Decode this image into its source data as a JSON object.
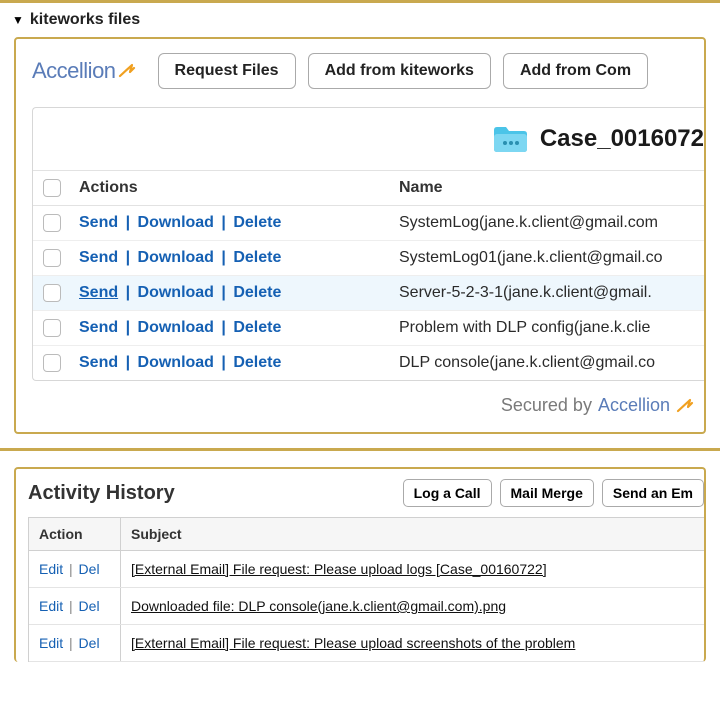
{
  "panel": {
    "title": "kiteworks files",
    "brand": "Accellion",
    "buttons": {
      "request": "Request Files",
      "add_kw": "Add from kiteworks",
      "add_com": "Add from Com"
    },
    "case_name": "Case_0016072",
    "headers": {
      "actions": "Actions",
      "name": "Name"
    },
    "action_labels": {
      "send": "Send",
      "download": "Download",
      "delete": "Delete"
    },
    "files": [
      {
        "name": "SystemLog(jane.k.client@gmail.com",
        "highlight": false
      },
      {
        "name": "SystemLog01(jane.k.client@gmail.co",
        "highlight": false
      },
      {
        "name": "Server-5-2-3-1(jane.k.client@gmail.",
        "highlight": true
      },
      {
        "name": "Problem with DLP config(jane.k.clie",
        "highlight": false
      },
      {
        "name": "DLP console(jane.k.client@gmail.co",
        "highlight": false
      }
    ],
    "secured_prefix": "Secured by",
    "secured_brand": "Accellion"
  },
  "activity": {
    "title": "Activity History",
    "buttons": {
      "log_call": "Log a Call",
      "mail_merge": "Mail Merge",
      "send_email": "Send an Em"
    },
    "headers": {
      "action": "Action",
      "subject": "Subject"
    },
    "action_labels": {
      "edit": "Edit",
      "del": "Del"
    },
    "rows": [
      {
        "subject": "[External Email] File request: Please upload logs [Case_00160722]"
      },
      {
        "subject": "Downloaded file: DLP console(jane.k.client@gmail.com).png"
      },
      {
        "subject": "[External Email] File request: Please upload screenshots of the problem"
      }
    ]
  }
}
